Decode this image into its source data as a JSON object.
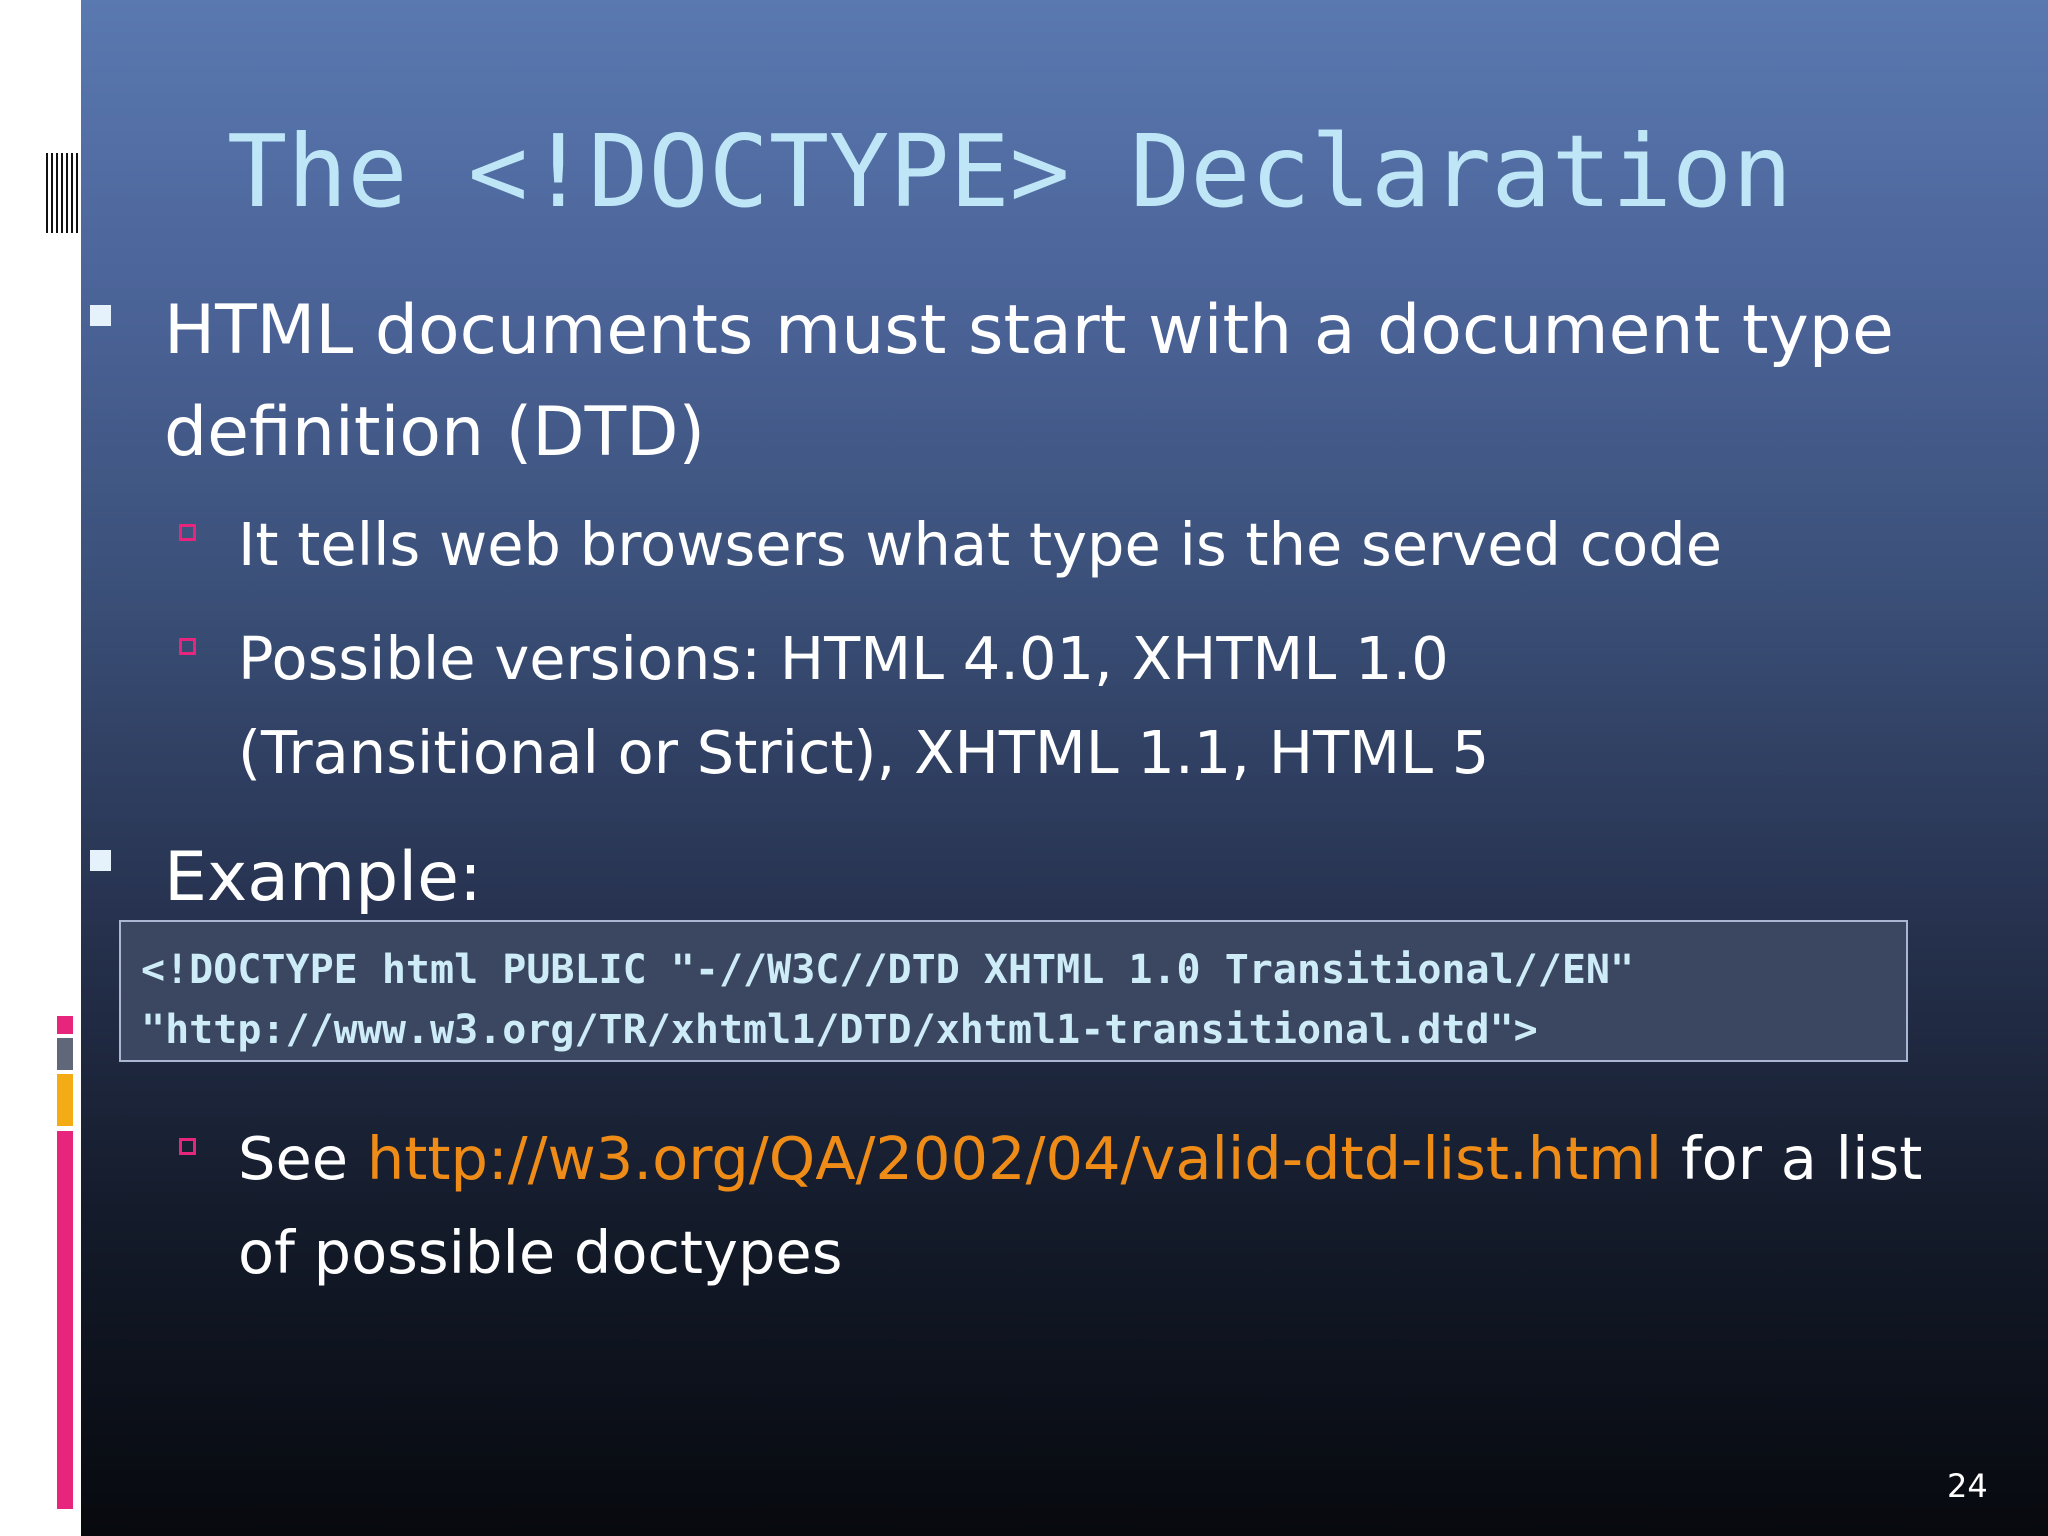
{
  "slide": {
    "title": "The <!DOCTYPE> Declaration",
    "bullet1": {
      "line1": "HTML documents must start with a document type",
      "line2": "definition (DTD)"
    },
    "sub1": "It tells web browsers what type is the served code",
    "sub2": {
      "line1": "Possible versions: HTML 4.01, XHTML 1.0",
      "line2": "(Transitional or Strict), XHTML 1.1, HTML 5"
    },
    "bullet2": "Example:",
    "code": {
      "line1": "<!DOCTYPE html PUBLIC \"-//W3C//DTD XHTML 1.0 Transitional//EN\"",
      "line2": "\"http://www.w3.org/TR/xhtml1/DTD/xhtml1-transitional.dtd\">"
    },
    "sub3": {
      "prefix": "See ",
      "link": "http://w3.org/QA/2002/04/valid-dtd-list.html",
      "suffix": " for a list",
      "line2": "of possible doctypes"
    },
    "page_number": "24"
  },
  "colors": {
    "title": "#bfe6f6",
    "link": "#ef8c17",
    "accent_pink": "#e8257c",
    "accent_orange": "#f3ab16"
  }
}
